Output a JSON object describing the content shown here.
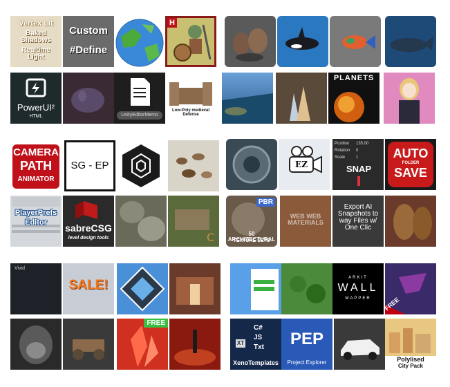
{
  "tiles": {
    "vertexlit": {
      "line1": "Vertex Lit",
      "line2": "Baked\nShadows",
      "line3": "Realtime\nLight"
    },
    "customdefine": {
      "line1": "Custom",
      "line2": "#Define"
    },
    "hbadge": {
      "text": "H"
    },
    "powerui": {
      "title": "PowerUI²",
      "subtitle": "HTML"
    },
    "editormemo": {
      "caption": "UnityEditorMemo"
    },
    "lowpoly": {
      "caption": "Low-Poly medieval\nDefense"
    },
    "planets": {
      "title": "PLANETS"
    },
    "camerapath": {
      "line1": "CAMERA",
      "line2": "PATH",
      "line3": "ANIMATOR"
    },
    "sgep": {
      "text": "SG - EP"
    },
    "ez": {
      "text": "EZ"
    },
    "snap": {
      "position_label": "Position",
      "position_value": "135.00",
      "rotation_label": "Rotation",
      "rotation_value": "0",
      "scale_label": "Scale",
      "scale_value": "1",
      "snap_text": "SNAP"
    },
    "autosave": {
      "line1": "AUTO",
      "line2": "FOLDER",
      "line3": "SAVE"
    },
    "playerprefs": {
      "line1": "PlayerPrefs",
      "line2": "Editor"
    },
    "sabrecsg": {
      "title": "sabreCSG",
      "subtitle": "level design tools"
    },
    "pbr": {
      "badge": "PBR",
      "line1": "50 ARCHITECTURAL",
      "line2": "TEXTURE SETS"
    },
    "webmaterials": {
      "text": "WEB WEB\nMATERIALS"
    },
    "exportai": {
      "text": "Export AI\nSnapshots to\nway Files w/\nOne Clic"
    },
    "sale": {
      "text": "SALE!",
      "small": "Vivid"
    },
    "arkit": {
      "line1": "ARKIT",
      "line2": "WALL",
      "line3": "MAPPER"
    },
    "free1": {
      "text": "FREE"
    },
    "free2": {
      "text": "FREE"
    },
    "xeno": {
      "c1": "C#",
      "c2": "JS",
      "c3": "Txt",
      "badge": "XT",
      "title": "XenoTemplates"
    },
    "pep": {
      "title": "PEP",
      "subtitle": "Project Explorer"
    },
    "polylised": {
      "line1": "Polylised",
      "line2": "City Pack"
    }
  }
}
